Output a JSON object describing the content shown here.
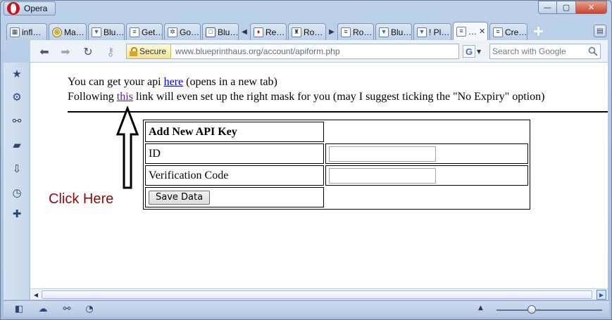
{
  "window": {
    "app_name": "Opera",
    "controls": {
      "minimize": "—",
      "maximize": "▢",
      "close": "✕"
    }
  },
  "tabs": [
    {
      "title": "infl…",
      "icon": "tab-favicon"
    },
    {
      "title": "Ma…",
      "icon": "tab-favicon"
    },
    {
      "title": "Blu…",
      "icon": "tab-favicon"
    },
    {
      "title": "Get…",
      "icon": "tab-favicon"
    },
    {
      "title": "Go…",
      "icon": "tab-favicon"
    },
    {
      "title": "Blu…",
      "icon": "tab-favicon"
    },
    {
      "title": "Re…",
      "icon": "tab-favicon"
    },
    {
      "title": "Ro…",
      "icon": "tab-favicon"
    },
    {
      "title": "Ro…",
      "icon": "tab-favicon"
    },
    {
      "title": "Blu…",
      "icon": "tab-favicon"
    },
    {
      "title": "! Pl…",
      "icon": "tab-favicon"
    },
    {
      "title": "…",
      "icon": "tab-favicon",
      "active": true
    },
    {
      "title": "Cre…",
      "icon": "tab-favicon"
    }
  ],
  "toolbar": {
    "secure_label": "Secure",
    "url": "www.blueprinthaus.org/account/apiform.php",
    "search_placeholder": "Search with Google",
    "search_engine_icon": "G"
  },
  "page": {
    "line1_before": "You can get your api ",
    "line1_link": "here",
    "line1_after": " (opens in a new tab)",
    "line2_before": "Following ",
    "line2_link": "this",
    "line2_after": " link will even set up the right mask for you (may I suggest ticking the \"No Expiry\" option)",
    "form": {
      "heading": "Add New API Key",
      "id_label": "ID",
      "id_value": "",
      "vcode_label": "Verification Code",
      "vcode_value": "",
      "save_label": "Save  Data"
    },
    "annotation": "Click Here"
  },
  "colors": {
    "link": "#0000ee",
    "visited_link": "#551a8b",
    "annotation": "#8b0a0a"
  }
}
